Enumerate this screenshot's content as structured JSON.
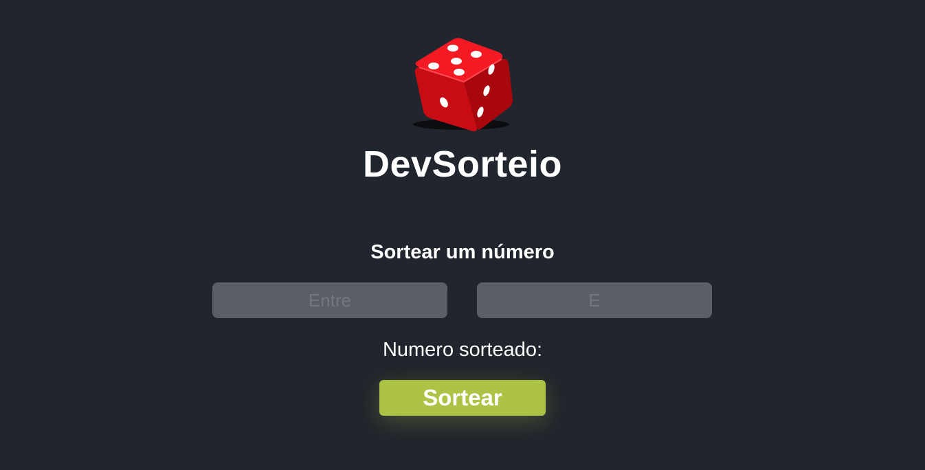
{
  "app": {
    "brand": "DevSorteio",
    "logo_icon": "red-dice-icon"
  },
  "main": {
    "heading": "Sortear um número",
    "min_input": {
      "placeholder": "Entre",
      "value": ""
    },
    "max_input": {
      "placeholder": "E",
      "value": ""
    },
    "result_label": "Numero sorteado:",
    "draw_button_label": "Sortear"
  },
  "colors": {
    "background": "#21252d",
    "input_background": "#5b5e66",
    "button_accent": "#acc345",
    "dice_red": "#e8101a"
  }
}
